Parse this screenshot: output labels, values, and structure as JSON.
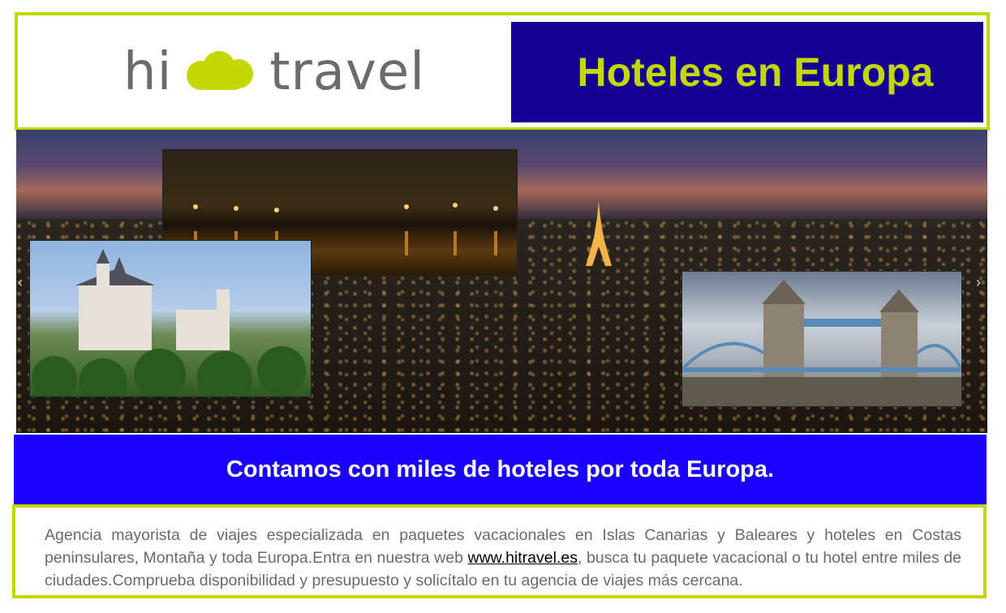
{
  "header": {
    "logo_left": "hi",
    "logo_right": "travel",
    "logo_cloud_icon": "cloud-icon",
    "title": "Hoteles en Europa"
  },
  "banner": {
    "prev_arrow": "‹",
    "next_arrow": "›"
  },
  "tagline": "Contamos con miles de hoteles por toda Europa.",
  "description": {
    "text_before": "Agencia mayorista de viajes especializada en paquetes vacacionales en Islas Canarias y Baleares y hoteles  en Costas peninsulares, Montaña y toda Europa.Entra en nuestra web ",
    "link_text": "www.hitravel.es",
    "text_after": ", busca tu paquete vacacional o tu hotel entre miles de ciudades.Comprueba disponibilidad y presupuesto y solicítalo en tu agencia de viajes más cercana."
  },
  "colors": {
    "accent_green": "#c4d800",
    "title_navy": "#150094",
    "tagline_blue": "#1a00ff",
    "logo_gray": "#6b6b6b",
    "body_text": "#6a6a6a"
  }
}
